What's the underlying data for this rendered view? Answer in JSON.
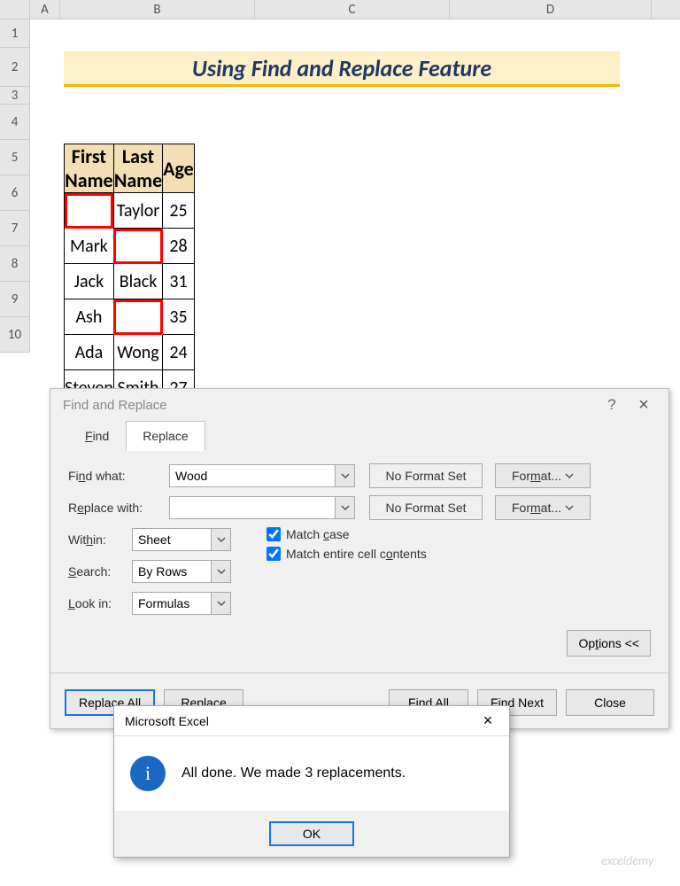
{
  "columns": {
    "A": "A",
    "B": "B",
    "C": "C",
    "D": "D"
  },
  "rows": {
    "1": "1",
    "2": "2",
    "3": "3",
    "4": "4",
    "5": "5",
    "6": "6",
    "7": "7",
    "8": "8",
    "9": "9",
    "10": "10"
  },
  "title_banner": "Using Find and Replace Feature",
  "headers": {
    "first": "First Name",
    "last": "Last Name",
    "age": "Age"
  },
  "table": [
    {
      "first": "",
      "last": "Taylor",
      "age": "25",
      "first_red": true,
      "last_red": false
    },
    {
      "first": "Mark",
      "last": "",
      "age": "28",
      "first_red": false,
      "last_red": true
    },
    {
      "first": "Jack",
      "last": "Black",
      "age": "31",
      "first_red": false,
      "last_red": false
    },
    {
      "first": "Ash",
      "last": "",
      "age": "35",
      "first_red": false,
      "last_red": true
    },
    {
      "first": "Ada",
      "last": "Wong",
      "age": "24",
      "first_red": false,
      "last_red": false
    },
    {
      "first": "Steven",
      "last": "Smith",
      "age": "27",
      "first_red": false,
      "last_red": false
    }
  ],
  "dialog": {
    "title": "Find and Replace",
    "tab_find": "Find",
    "tab_replace": "Replace",
    "find_what_lbl": "Find what:",
    "find_what_val": "Wood",
    "replace_with_lbl": "Replace with:",
    "replace_with_val": "",
    "no_format": "No Format Set",
    "format_btn": "Format...",
    "within_lbl": "Within:",
    "within_val": "Sheet",
    "search_lbl": "Search:",
    "search_val": "By Rows",
    "lookin_lbl": "Look in:",
    "lookin_val": "Formulas",
    "match_case": "Match case",
    "match_contents": "Match entire cell contents",
    "options_btn": "Options <<",
    "replace_all": "Replace All",
    "replace": "Replace",
    "find_all": "Find All",
    "find_next": "Find Next",
    "close": "Close"
  },
  "msgbox": {
    "title": "Microsoft Excel",
    "text": "All done. We made 3 replacements.",
    "ok": "OK"
  },
  "icons": {
    "chevron_down": "chevron-down",
    "help": "?",
    "close": "×",
    "info": "i"
  },
  "watermark": "exceldemy"
}
